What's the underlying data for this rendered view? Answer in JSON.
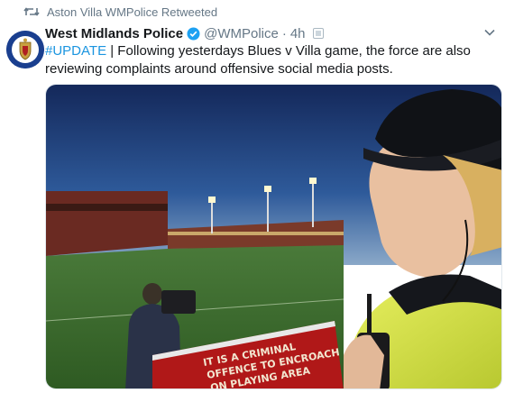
{
  "retweet": {
    "icon": "retweet-icon",
    "text": "Aston Villa WMPolice Retweeted"
  },
  "tweet": {
    "display_name": "West Midlands Police",
    "verified": true,
    "handle": "@WMPolice",
    "separator": "·",
    "time": "4h",
    "hashtag": "#UPDATE",
    "body_text": " | Following yesterdays Blues v Villa game, the force are also reviewing complaints around offensive social media posts."
  },
  "media": {
    "description_icon": "photo",
    "sign_lines": [
      "IT IS A CRIMINAL",
      "OFFENCE TO ENCROACH",
      "ON PLAYING AREA"
    ]
  },
  "colors": {
    "link": "#1b95e0",
    "secondary_text": "#657786",
    "verified": "#1da1f2"
  }
}
